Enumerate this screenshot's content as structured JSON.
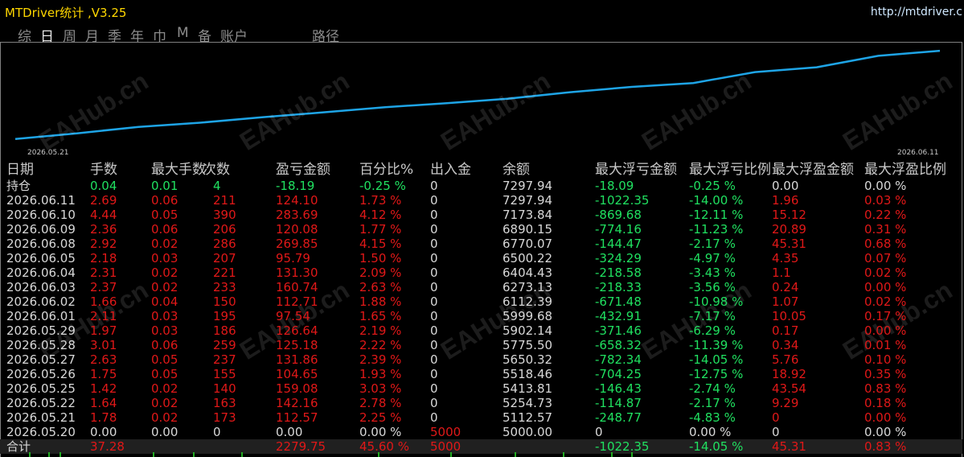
{
  "app": {
    "title": "MTDriver统计 ,V3.25",
    "url": "http://mtdriver.c"
  },
  "tabs": [
    "综",
    "日",
    "周",
    "月",
    "季",
    "年",
    "巾",
    "M",
    "备",
    "账户",
    "路径"
  ],
  "active_tab": "日",
  "chart": {
    "start_label": "2026.05.21",
    "end_label": "2026.06.11",
    "line_color": "#1ea4e6",
    "balance": [
      5112.57,
      5254.73,
      5413.81,
      5518.46,
      5650.32,
      5775.5,
      5902.14,
      5999.68,
      6112.39,
      6273.13,
      6404.43,
      6500.22,
      6770.07,
      6890.15,
      7173.84,
      7297.94
    ]
  },
  "watermark": "EAHub.cn",
  "columns": [
    "日期",
    "手数",
    "最大手数",
    "次数",
    "盈亏金额",
    "百分比%",
    "出入金",
    "余额",
    "最大浮亏金额",
    "最大浮亏比例",
    "最大浮盈金额",
    "最大浮盈比例"
  ],
  "holding": [
    "持仓",
    "0.04",
    "0.01",
    "4",
    "-18.19",
    "-0.25 %",
    "0",
    "7297.94",
    "-18.09",
    "-0.25 %",
    "0.00",
    "0.00 %"
  ],
  "rows": [
    [
      "2026.06.11",
      "2.69",
      "0.06",
      "211",
      "124.10",
      "1.73 %",
      "0",
      "7297.94",
      "-1022.35",
      "-14.00 %",
      "1.96",
      "0.03 %"
    ],
    [
      "2026.06.10",
      "4.44",
      "0.05",
      "390",
      "283.69",
      "4.12 %",
      "0",
      "7173.84",
      "-869.68",
      "-12.11 %",
      "15.12",
      "0.22 %"
    ],
    [
      "2026.06.09",
      "2.36",
      "0.06",
      "206",
      "120.08",
      "1.77 %",
      "0",
      "6890.15",
      "-774.16",
      "-11.23 %",
      "20.89",
      "0.31 %"
    ],
    [
      "2026.06.08",
      "2.92",
      "0.02",
      "286",
      "269.85",
      "4.15 %",
      "0",
      "6770.07",
      "-144.47",
      "-2.17 %",
      "45.31",
      "0.68 %"
    ],
    [
      "2026.06.05",
      "2.18",
      "0.03",
      "207",
      "95.79",
      "1.50 %",
      "0",
      "6500.22",
      "-324.29",
      "-4.97 %",
      "4.35",
      "0.07 %"
    ],
    [
      "2026.06.04",
      "2.31",
      "0.02",
      "221",
      "131.30",
      "2.09 %",
      "0",
      "6404.43",
      "-218.58",
      "-3.43 %",
      "1.1",
      "0.02 %"
    ],
    [
      "2026.06.03",
      "2.37",
      "0.02",
      "233",
      "160.74",
      "2.63 %",
      "0",
      "6273.13",
      "-218.33",
      "-3.56 %",
      "0.24",
      "0.00 %"
    ],
    [
      "2026.06.02",
      "1.66",
      "0.04",
      "150",
      "112.71",
      "1.88 %",
      "0",
      "6112.39",
      "-671.48",
      "-10.98 %",
      "1.07",
      "0.02 %"
    ],
    [
      "2026.06.01",
      "2.11",
      "0.03",
      "195",
      "97.54",
      "1.65 %",
      "0",
      "5999.68",
      "-432.91",
      "-7.17 %",
      "10.05",
      "0.17 %"
    ],
    [
      "2026.05.29",
      "1.97",
      "0.03",
      "186",
      "126.64",
      "2.19 %",
      "0",
      "5902.14",
      "-371.46",
      "-6.29 %",
      "0.17",
      "0.00 %"
    ],
    [
      "2026.05.28",
      "3.01",
      "0.06",
      "259",
      "125.18",
      "2.22 %",
      "0",
      "5775.50",
      "-658.32",
      "-11.39 %",
      "0.34",
      "0.01 %"
    ],
    [
      "2026.05.27",
      "2.63",
      "0.05",
      "237",
      "131.86",
      "2.39 %",
      "0",
      "5650.32",
      "-782.34",
      "-14.05 %",
      "5.76",
      "0.10 %"
    ],
    [
      "2026.05.26",
      "1.75",
      "0.05",
      "155",
      "104.65",
      "1.93 %",
      "0",
      "5518.46",
      "-704.25",
      "-12.75 %",
      "18.92",
      "0.35 %"
    ],
    [
      "2026.05.25",
      "1.42",
      "0.02",
      "140",
      "159.08",
      "3.03 %",
      "0",
      "5413.81",
      "-146.43",
      "-2.74 %",
      "43.54",
      "0.83 %"
    ],
    [
      "2026.05.22",
      "1.64",
      "0.02",
      "163",
      "142.16",
      "2.78 %",
      "0",
      "5254.73",
      "-114.87",
      "-2.17 %",
      "9.29",
      "0.18 %"
    ],
    [
      "2026.05.21",
      "1.78",
      "0.02",
      "173",
      "112.57",
      "2.25 %",
      "0",
      "5112.57",
      "-248.77",
      "-4.83 %",
      "0",
      "0.00 %"
    ],
    [
      "2026.05.20",
      "0.00",
      "0.00",
      "0",
      "0.00",
      "0.00 %",
      "5000",
      "5000.00",
      "0",
      "0.00 %",
      "0",
      "0.00 %"
    ]
  ],
  "totals": [
    "合计",
    "37.28",
    "",
    "",
    "2279.75",
    "45.60 %",
    "5000",
    "",
    "-1022.35",
    "-14.05 %",
    "45.31",
    "0.83 %"
  ]
}
